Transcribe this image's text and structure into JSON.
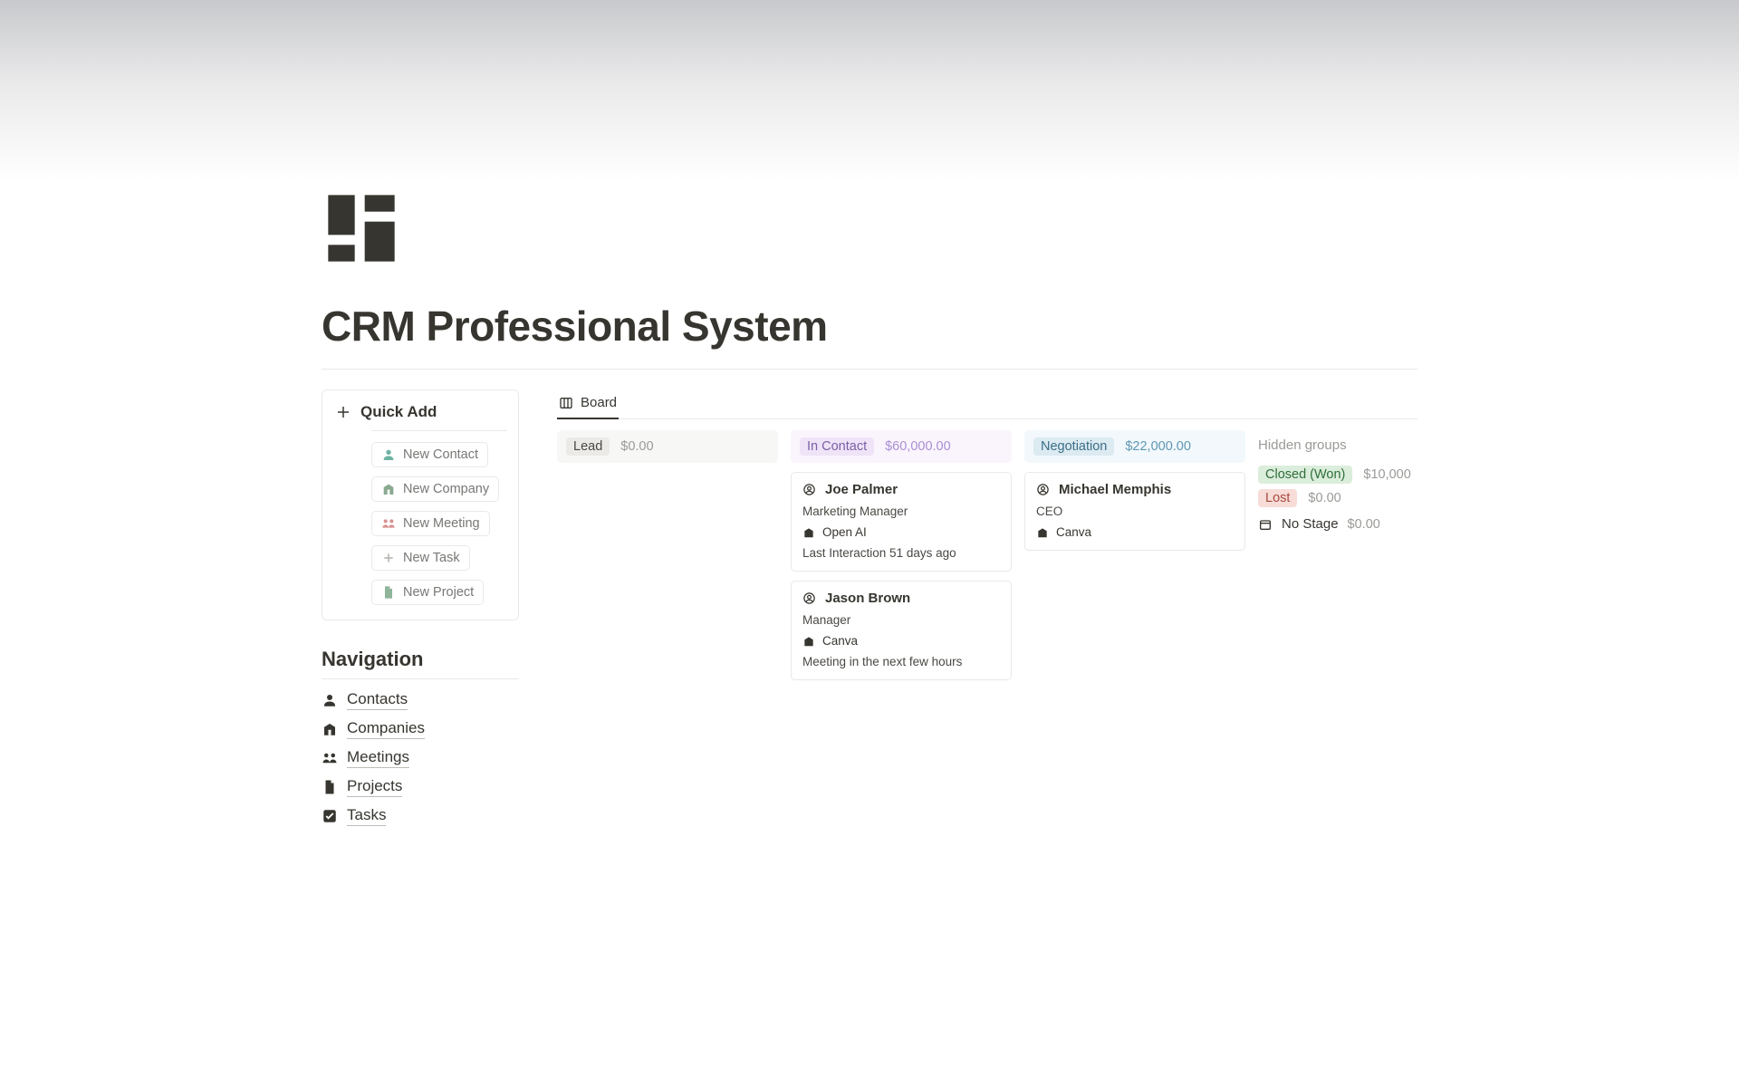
{
  "page": {
    "title": "CRM Professional System"
  },
  "quick_add": {
    "title": "Quick Add",
    "items": [
      {
        "label": "New Contact",
        "icon": "person-icon",
        "color": "#5aa999"
      },
      {
        "label": "New Company",
        "icon": "building-icon",
        "color": "#8aa98f"
      },
      {
        "label": "New Meeting",
        "icon": "people-icon",
        "color": "#d88f8f"
      },
      {
        "label": "New Task",
        "icon": "plus-icon",
        "color": "#b9b9b5"
      },
      {
        "label": "New Project",
        "icon": "file-icon",
        "color": "#8fb59b"
      }
    ]
  },
  "navigation": {
    "heading": "Navigation",
    "items": [
      {
        "label": "Contacts",
        "icon": "person-solid-icon"
      },
      {
        "label": "Companies",
        "icon": "building-icon"
      },
      {
        "label": "Meetings",
        "icon": "people-icon"
      },
      {
        "label": "Projects",
        "icon": "file-icon"
      },
      {
        "label": "Tasks",
        "icon": "checkbox-icon"
      }
    ]
  },
  "tabs": {
    "board": "Board"
  },
  "board": {
    "columns": [
      {
        "key": "lead",
        "label": "Lead",
        "amount": "$0.00",
        "cards": []
      },
      {
        "key": "in_contact",
        "label": "In Contact",
        "amount": "$60,000.00",
        "cards": [
          {
            "name": "Joe Palmer",
            "role": "Marketing Manager",
            "company": "Open AI",
            "meta": "Last Interaction 51 days ago"
          },
          {
            "name": "Jason Brown",
            "role": "Manager",
            "company": "Canva",
            "meta": "Meeting in the next few hours"
          }
        ]
      },
      {
        "key": "negotiation",
        "label": "Negotiation",
        "amount": "$22,000.00",
        "cards": [
          {
            "name": "Michael Memphis",
            "role": "CEO",
            "company": "Canva",
            "meta": ""
          }
        ]
      }
    ],
    "hidden": {
      "heading": "Hidden groups",
      "groups": [
        {
          "label": "Closed (Won)",
          "amount": "$10,000",
          "tag_class": "tag-won"
        },
        {
          "label": "Lost",
          "amount": "$0.00",
          "tag_class": "tag-lost"
        }
      ],
      "no_stage": {
        "label": "No Stage",
        "amount": "$0.00"
      }
    }
  }
}
